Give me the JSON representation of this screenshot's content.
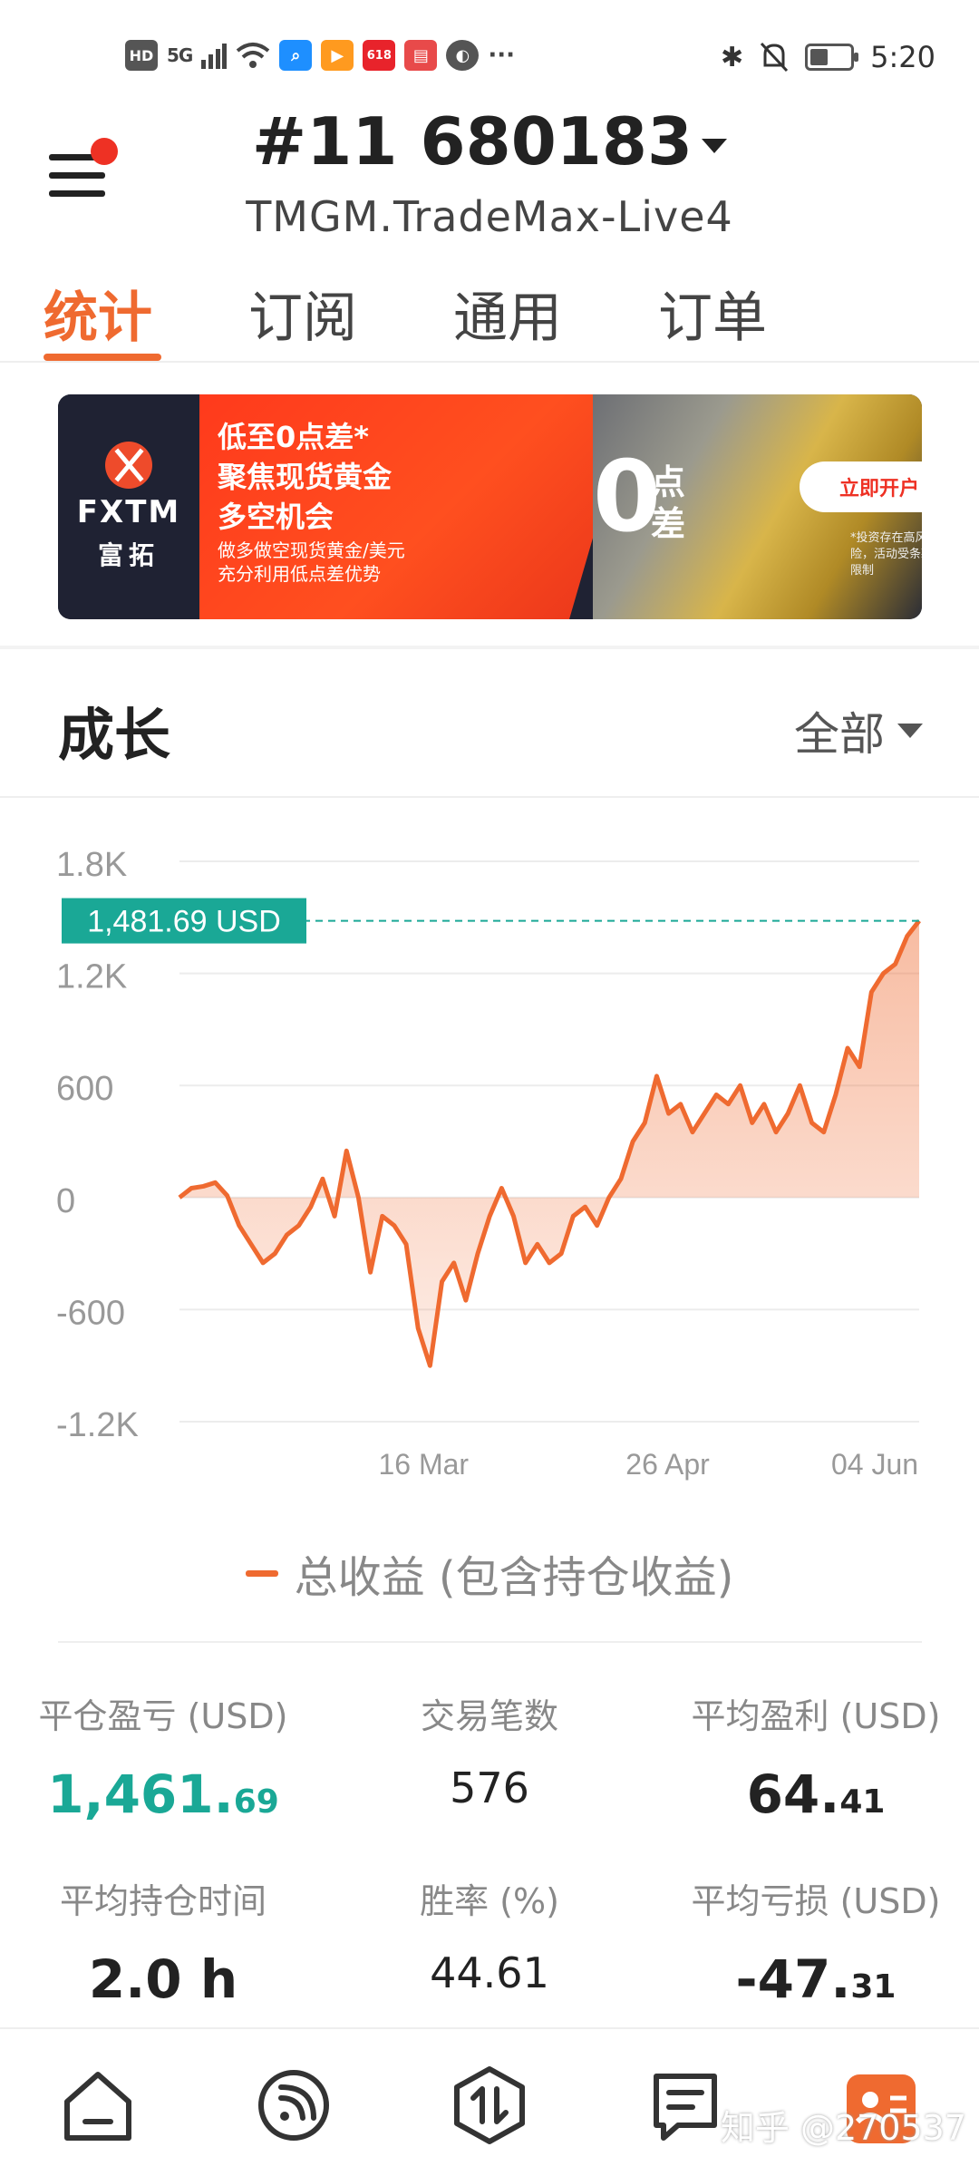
{
  "status_bar": {
    "left_items": [
      "HD",
      "5G",
      "wifi-icon",
      "search-app-icon",
      "video-app-icon",
      "618",
      "book-app-icon",
      "browser-app-icon",
      "···"
    ],
    "hd": "HD",
    "net": "5G",
    "more": "···",
    "promo": "618",
    "time": "5:20"
  },
  "header": {
    "account": "#11  680183",
    "server": "TMGM.TradeMax-Live4"
  },
  "tabs": [
    {
      "label": "统计",
      "active": true
    },
    {
      "label": "订阅",
      "active": false
    },
    {
      "label": "通用",
      "active": false
    },
    {
      "label": "订单",
      "active": false
    }
  ],
  "banner": {
    "brand": "FXTM",
    "brand_cn": "富拓",
    "line1": "低至0点差*",
    "line2": "聚焦现货黄金",
    "line3": "多空机会",
    "line4": "做多做空现货黄金/美元",
    "line5": "充分利用低点差优势",
    "big": "0",
    "small1": "点",
    "small2": "差",
    "button": "立即开户",
    "risk": "*投资存在高风险，活动受条款限制"
  },
  "growth": {
    "title": "成长",
    "filter": "全部"
  },
  "chart_data": {
    "type": "area",
    "current_label": "1,481.69 USD",
    "current_value": 1481.69,
    "y_ticks": [
      "1.8K",
      "1.2K",
      "600",
      "0",
      "-600",
      "-1.2K"
    ],
    "y_tick_values": [
      1800,
      1200,
      600,
      0,
      -600,
      -1200
    ],
    "ylim": [
      -1200,
      1800
    ],
    "x_ticks": [
      "16 Mar",
      "26 Apr",
      "04 Jun"
    ],
    "x_tick_positions": [
      0.33,
      0.66,
      0.94
    ],
    "series": [
      {
        "name": "总收益 (包含持仓收益)",
        "color": "#ef6a30",
        "values": [
          0,
          50,
          60,
          80,
          10,
          -150,
          -250,
          -350,
          -300,
          -200,
          -150,
          -50,
          100,
          -100,
          250,
          0,
          -400,
          -100,
          -150,
          -250,
          -700,
          -900,
          -450,
          -350,
          -550,
          -300,
          -100,
          50,
          -100,
          -350,
          -250,
          -350,
          -300,
          -100,
          -50,
          -150,
          0,
          100,
          300,
          400,
          650,
          450,
          500,
          350,
          450,
          550,
          500,
          600,
          400,
          500,
          350,
          450,
          600,
          400,
          350,
          550,
          800,
          700,
          1100,
          1200,
          1250,
          1400,
          1481.69
        ]
      }
    ]
  },
  "legend": {
    "label": "总收益 (包含持仓收益)"
  },
  "stats": {
    "closed_pl": {
      "label": "平仓盈亏 (USD)",
      "int": "1,461.",
      "dec": "69"
    },
    "trades": {
      "label": "交易笔数",
      "value": "576"
    },
    "avg_profit": {
      "label": "平均盈利 (USD)",
      "int": "64.",
      "dec": "41"
    },
    "avg_hold": {
      "label": "平均持仓时间",
      "value": "2.0 h"
    },
    "win_rate": {
      "label": "胜率 (%)",
      "value": "44.61"
    },
    "avg_loss": {
      "label": "平均亏损 (USD)",
      "int": "-47.",
      "dec": "31"
    }
  },
  "nav": [
    "home-icon",
    "subscription-icon",
    "trade-icon",
    "orders-icon",
    "profile-icon"
  ],
  "watermark": "知乎 @270537"
}
